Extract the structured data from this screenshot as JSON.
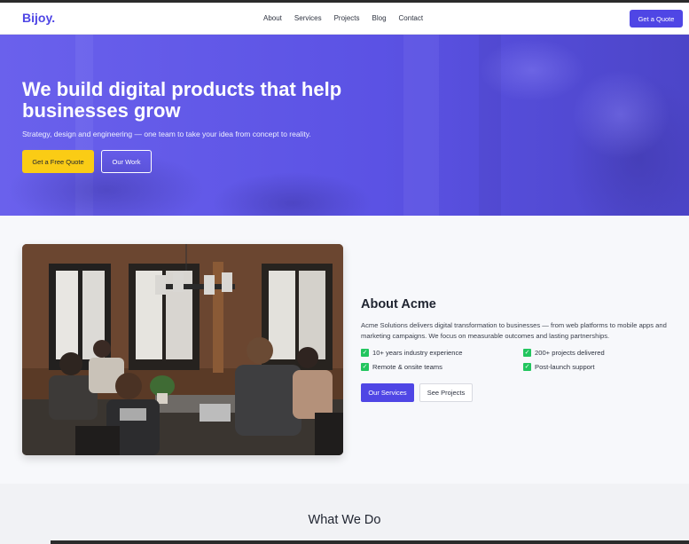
{
  "nav": {
    "brand": "Bijoy",
    "brand_dot": ".",
    "links": [
      "About",
      "Services",
      "Projects",
      "Blog",
      "Contact"
    ],
    "cta": "Get a Quote"
  },
  "hero": {
    "title": "We build digital products that help businesses grow",
    "subtitle": "Strategy, design and engineering — one team to take your idea from concept to reality.",
    "primary_button": "Get a Free Quote",
    "secondary_button": "Our Work"
  },
  "about": {
    "title": "About Acme",
    "description": "Acme Solutions delivers digital transformation to businesses — from web platforms to mobile apps and marketing campaigns. We focus on measurable outcomes and lasting partnerships.",
    "features": [
      "10+ years industry experience",
      "200+ projects delivered",
      "Remote & onsite teams",
      "Post-launch support"
    ],
    "primary_button": "Our Services",
    "secondary_button": "See Projects"
  },
  "whatwedo": {
    "title": "What We Do"
  },
  "colors": {
    "brand": "#4f46e5",
    "hero_bg": "#5b52e4",
    "accent_yellow": "#facc15",
    "check_green": "#22c55e"
  }
}
